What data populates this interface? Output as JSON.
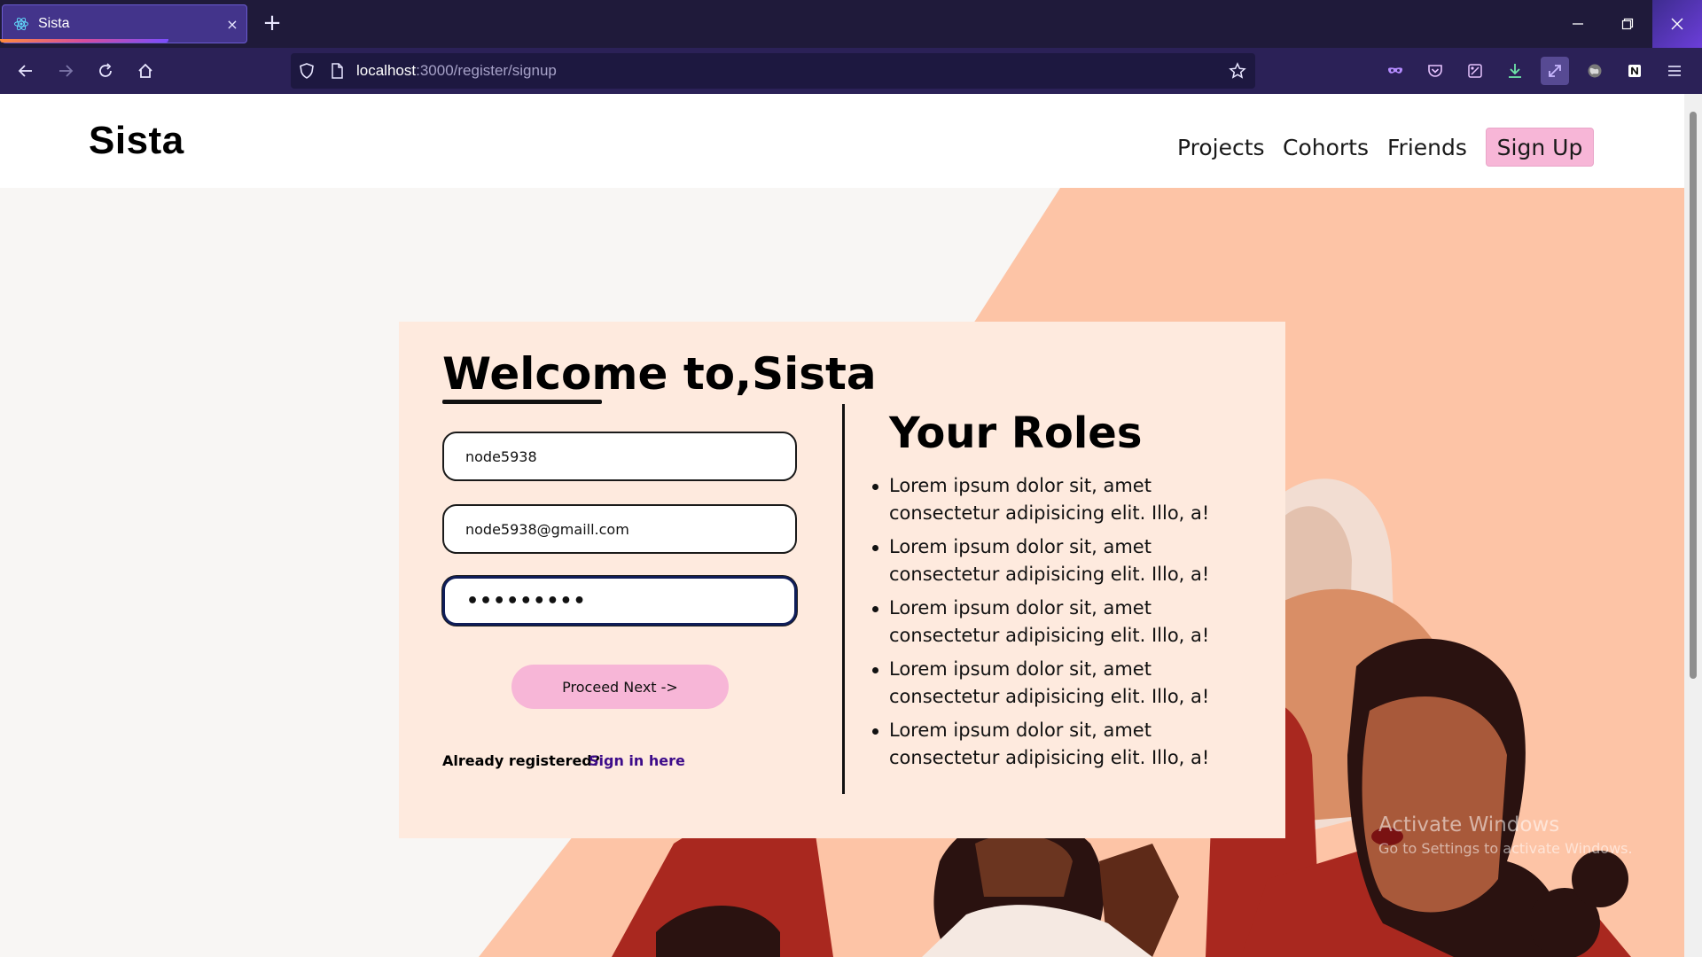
{
  "browser": {
    "tab_title": "Sista",
    "tab_close": "×",
    "new_tab": "+",
    "url_host": "localhost",
    "url_path": ":3000/register/signup"
  },
  "site": {
    "logo": "Sista",
    "nav": [
      "Projects",
      "Cohorts",
      "Friends"
    ],
    "signup_label": "Sign Up"
  },
  "form": {
    "heading": "Welcome to,Sista",
    "username_value": "node5938",
    "email_value": "node5938@gmaill.com",
    "password_mask": "•••••••••",
    "proceed_label": "Proceed Next ->",
    "already_text": "Already registered?",
    "signin_label": "Sign in here"
  },
  "roles": {
    "title": "Your Roles",
    "items": [
      "Lorem ipsum dolor sit, amet consectetur adipisicing elit. Illo, a!",
      "Lorem ipsum dolor sit, amet consectetur adipisicing elit. Illo, a!",
      "Lorem ipsum dolor sit, amet consectetur adipisicing elit. Illo, a!",
      "Lorem ipsum dolor sit, amet consectetur adipisicing elit. Illo, a!",
      "Lorem ipsum dolor sit, amet consectetur adipisicing elit. Illo, a!"
    ]
  },
  "watermark": {
    "line1": "Activate Windows",
    "line2": "Go to Settings to activate Windows."
  },
  "colors": {
    "chrome_dark": "#1f1a3a",
    "chrome_toolbar": "#2b2157",
    "accent_pink": "#f7b6d7",
    "card_bg": "#feeade",
    "peach": "#fdc4a6",
    "link_purple": "#3d0c8a"
  },
  "icons": [
    "react-icon",
    "back-arrow-icon",
    "forward-arrow-icon",
    "reload-icon",
    "home-icon",
    "shield-icon",
    "page-icon",
    "star-icon",
    "mask-icon",
    "pocket-icon",
    "extension-icon",
    "download-icon",
    "resize-icon",
    "globe-icon",
    "notion-icon",
    "menu-icon",
    "minimize-icon",
    "restore-icon",
    "close-icon"
  ]
}
